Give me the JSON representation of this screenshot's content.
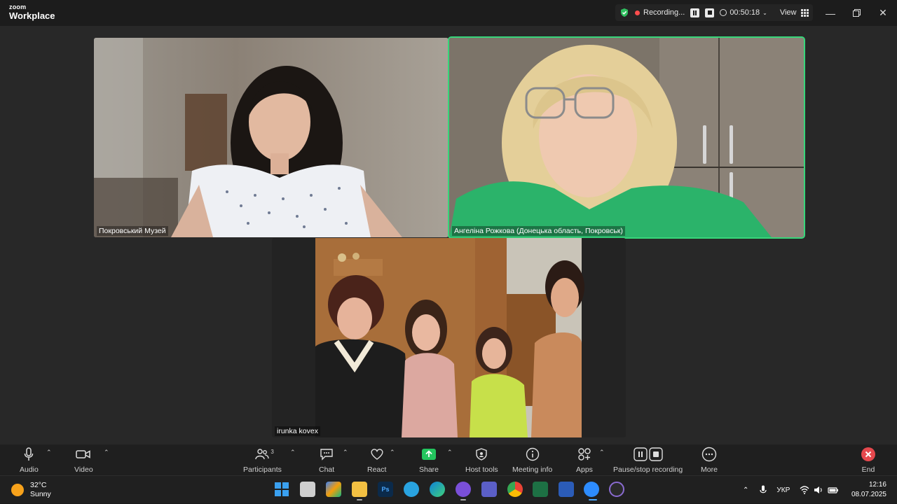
{
  "app": {
    "brand_top": "zoom",
    "brand_bottom": "Workplace"
  },
  "recording": {
    "status": "Recording...",
    "elapsed": "00:50:18",
    "view_label": "View"
  },
  "participants": [
    {
      "name": "Покровський Музей"
    },
    {
      "name": "Ангеліна Рожкова (Донецька область, Покровськ)"
    },
    {
      "name": "irunka kovex"
    }
  ],
  "toolbar": {
    "audio": "Audio",
    "video": "Video",
    "participants": "Participants",
    "participants_count": "3",
    "chat": "Chat",
    "react": "React",
    "share": "Share",
    "host_tools": "Host tools",
    "meeting_info": "Meeting info",
    "apps": "Apps",
    "pause_stop": "Pause/stop recording",
    "more": "More",
    "end": "End"
  },
  "taskbar": {
    "weather_temp": "32°C",
    "weather_desc": "Sunny",
    "language": "УКР",
    "time": "12:16",
    "date": "08.07.2025"
  },
  "colors": {
    "active_speaker": "#37d67a",
    "share_green": "#23c55e",
    "end_red": "#e5484d",
    "accent_blue": "#2d8cff"
  }
}
